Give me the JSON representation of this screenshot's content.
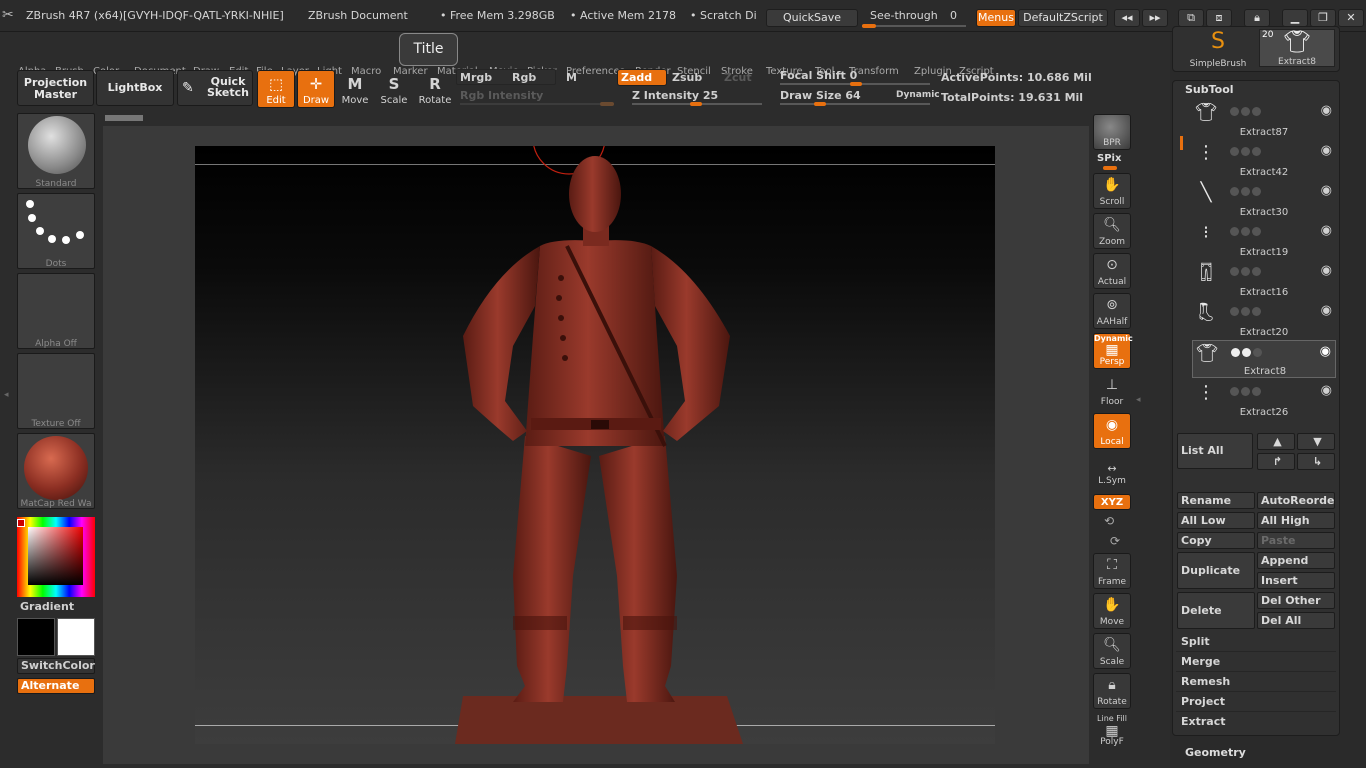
{
  "titlebar": {
    "app_title": "ZBrush 4R7 (x64)[GVYH-IDQF-QATL-YRKI-NHIE]",
    "document": "ZBrush Document",
    "free_mem": "• Free Mem 3.298GB",
    "active_mem": "• Active Mem 2178",
    "scratch": "• Scratch Di",
    "quicksave": "QuickSave",
    "see_through_label": "See-through",
    "see_through_value": "0",
    "menus": "Menus",
    "default_script": "DefaultZScript"
  },
  "menubar": [
    "Alpha",
    "Brush",
    "Color",
    "Document",
    "Draw",
    "Edit",
    "File",
    "Layer",
    "Light",
    "Macro",
    "Marker",
    "Material",
    "Movie",
    "Picker",
    "Preferences",
    "Render",
    "Stencil",
    "Stroke",
    "Texture",
    "Tool",
    "Transform",
    "Zplugin",
    "Zscript"
  ],
  "tooltip": "Title",
  "shelf": {
    "projection_master": "Projection Master",
    "lightbox": "LightBox",
    "quick_sketch": "Quick Sketch",
    "edit": "Edit",
    "draw": "Draw",
    "move": "Move",
    "scale": "Scale",
    "rotate": "Rotate",
    "mrgb": "Mrgb",
    "rgb": "Rgb",
    "m": "M",
    "rgb_intensity": "Rgb Intensity",
    "zadd": "Zadd",
    "zsub": "Zsub",
    "zcut": "Zcut",
    "z_intensity": "Z Intensity 25",
    "focal_shift": "Focal Shift 0",
    "draw_size": "Draw Size 64",
    "dynamic": "Dynamic",
    "active_points": "ActivePoints: 10.686 Mil",
    "total_points": "TotalPoints: 19.631 Mil"
  },
  "left_tray": {
    "brush": "Standard",
    "stroke": "Dots",
    "alpha": "Alpha Off",
    "texture": "Texture Off",
    "material": "MatCap Red Wa",
    "gradient": "Gradient",
    "switch_color": "SwitchColor",
    "alternate": "Alternate"
  },
  "right_tray": {
    "bpr": "BPR",
    "spix": "SPix",
    "scroll": "Scroll",
    "zoom": "Zoom",
    "actual": "Actual",
    "aahalf": "AAHalf",
    "dynamic": "Dynamic",
    "persp": "Persp",
    "floor": "Floor",
    "local": "Local",
    "lsym": "L.Sym",
    "xyz": "XYZ",
    "frame": "Frame",
    "move": "Move",
    "scale": "Scale",
    "rotate": "Rotate",
    "line_fill": "Line Fill",
    "polyf": "PolyF"
  },
  "tool_palette": {
    "simple_brush": "SimpleBrush",
    "extract_thumb": "Extract8",
    "extract_count": "20"
  },
  "subtool": {
    "title": "SubTool",
    "items": [
      {
        "name": "Extract87"
      },
      {
        "name": "Extract42"
      },
      {
        "name": "Extract30"
      },
      {
        "name": "Extract19"
      },
      {
        "name": "Extract16"
      },
      {
        "name": "Extract20"
      },
      {
        "name": "Extract8"
      },
      {
        "name": "Extract26"
      }
    ],
    "list_all": "List All",
    "rename": "Rename",
    "auto_reorder": "AutoReorder",
    "all_low": "All Low",
    "all_high": "All High",
    "copy": "Copy",
    "paste": "Paste",
    "duplicate": "Duplicate",
    "append": "Append",
    "insert": "Insert",
    "delete": "Delete",
    "del_other": "Del Other",
    "del_all": "Del All",
    "split": "Split",
    "merge": "Merge",
    "remesh": "Remesh",
    "project": "Project",
    "extract": "Extract"
  },
  "geometry": "Geometry",
  "colors": {
    "accent": "#e8700f",
    "panel": "#303030",
    "model": "#8b2e22"
  }
}
